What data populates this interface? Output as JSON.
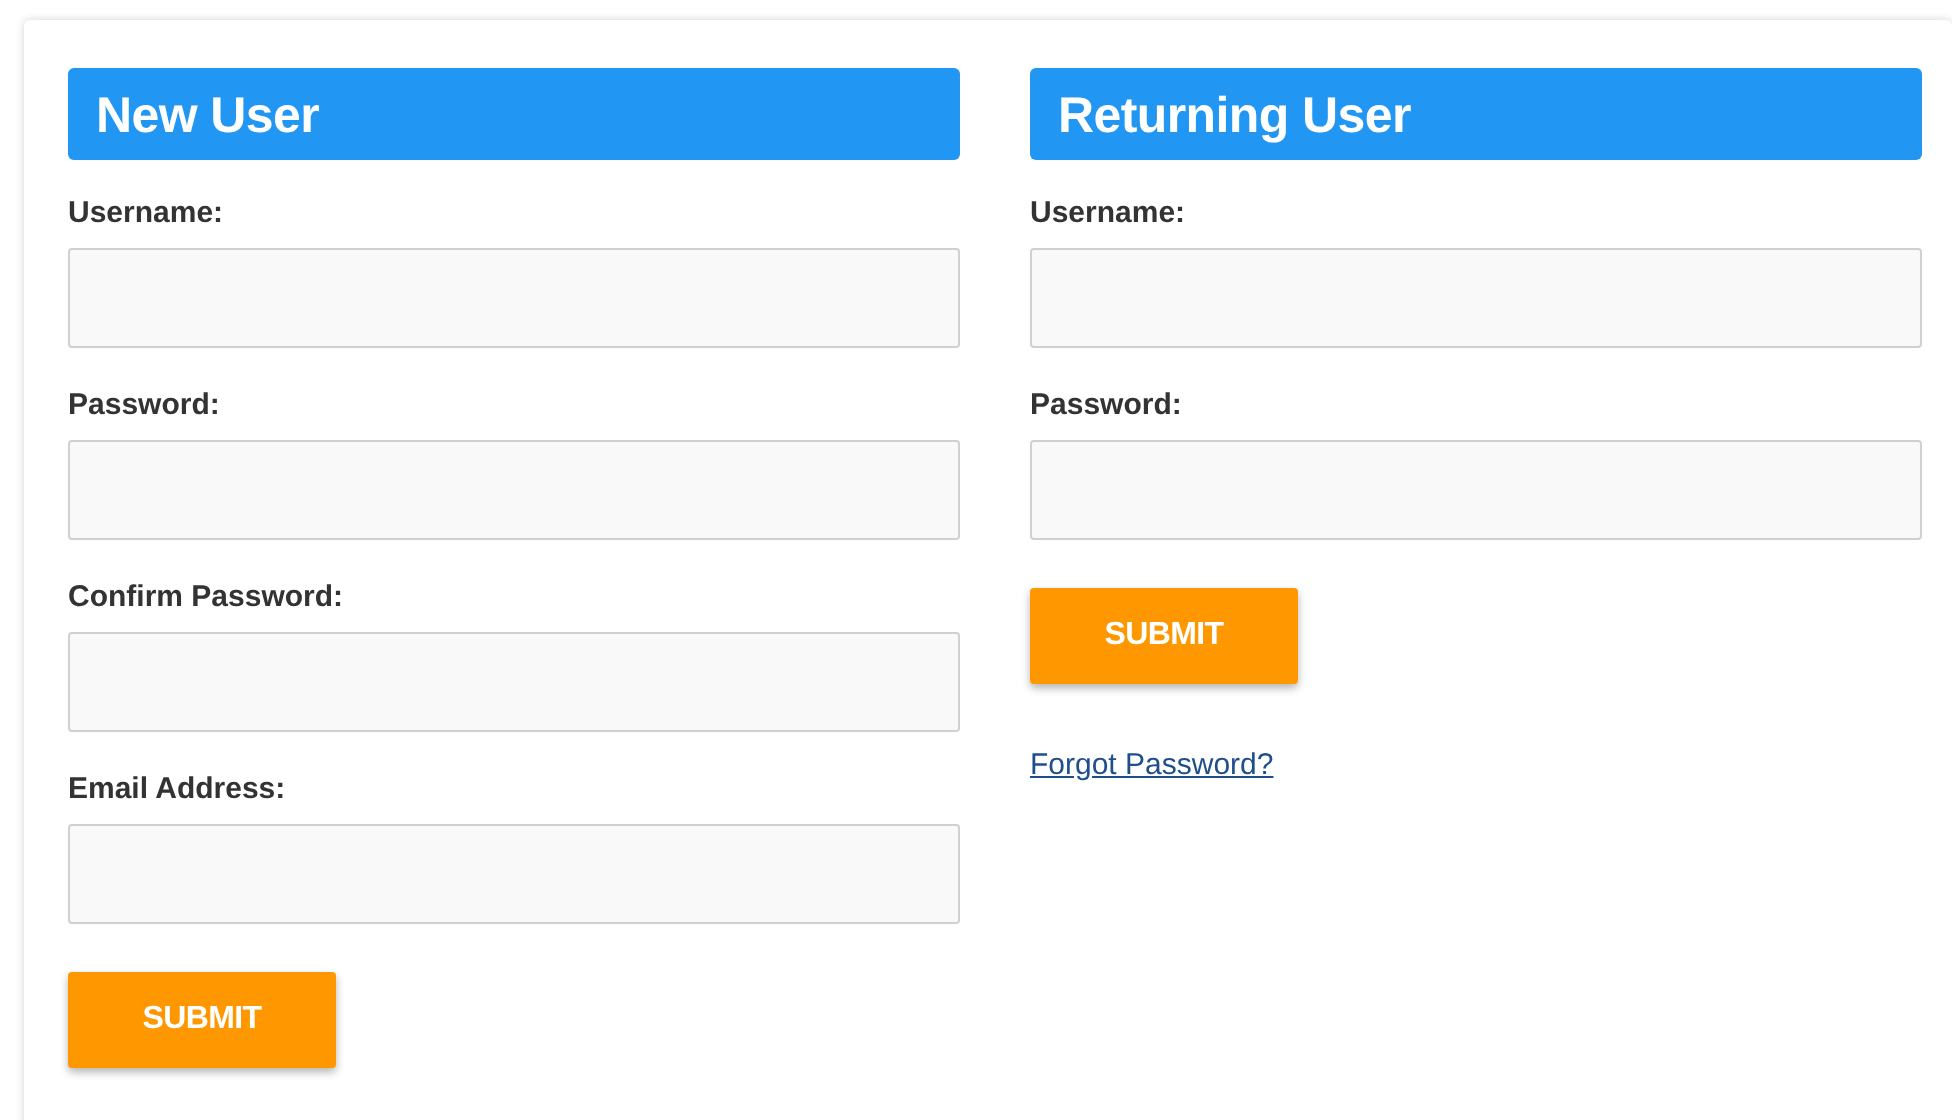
{
  "panels": [
    {
      "title": "New User",
      "fields": [
        {
          "label": "Username:"
        },
        {
          "label": "Password:"
        },
        {
          "label": "Confirm Password:"
        },
        {
          "label": "Email Address:"
        }
      ],
      "button": "SUBMIT"
    },
    {
      "title": "Returning User",
      "fields": [
        {
          "label": "Username:"
        },
        {
          "label": "Password:"
        }
      ],
      "button": "SUBMIT",
      "link": "Forgot Password?"
    }
  ]
}
